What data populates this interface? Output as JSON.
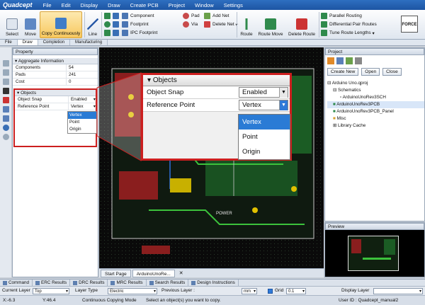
{
  "menubar": {
    "logo": "Quadcept",
    "items": [
      "File",
      "Edit",
      "Display",
      "Draw",
      "Create PCB",
      "Project",
      "Window",
      "Settings"
    ],
    "brand_color": "#1d55a3"
  },
  "toolbar": {
    "select": "Select",
    "move": "Move",
    "copy_continuously": "Copy Continuously",
    "line": "Line",
    "component": "Component",
    "footprint": "Footprint",
    "ipc_footprint": "IPC Footprint",
    "pad": "Pad",
    "via": "Via",
    "add_net": "Add Net",
    "delete_net": "Delete Net",
    "route": "Route",
    "route_move": "Route Move",
    "delete_route": "Delete Route",
    "parallel_routing": "Parallel Routing",
    "differential_pair_routes": "Differential Pair Routes",
    "tune_route_lengths": "Tune Route Lengths",
    "force_label": "FORCE"
  },
  "ribbon_tabs": [
    "File",
    "Draw",
    "Completion",
    "Manufacturing"
  ],
  "property": {
    "title": "Property",
    "aggregate_section": "Aggregate Information",
    "aggregate_rows": [
      {
        "key": "Components",
        "value": "54"
      },
      {
        "key": "Pads",
        "value": "241"
      },
      {
        "key": "Cost",
        "value": "0"
      }
    ],
    "objects_section": "Objects",
    "object_snap_key": "Object Snap",
    "object_snap_value": "Enabled",
    "reference_point_key": "Reference Point",
    "reference_point_value": "Vertex",
    "reference_options": [
      "Vertex",
      "Point",
      "Origin"
    ]
  },
  "callout": {
    "title": "Objects",
    "object_snap_key": "Object Snap",
    "object_snap_value": "Enabled",
    "reference_point_key": "Reference Point",
    "reference_point_value": "Vertex",
    "options": [
      "Vertex",
      "Point",
      "Origin"
    ],
    "border_color": "#cc1f1f"
  },
  "canvas": {
    "tabs": [
      "Start Page",
      "ArduinoUnoRe..."
    ],
    "silk_text": "POWER"
  },
  "project": {
    "title": "Project",
    "buttons": [
      "Create New",
      "Open",
      "Close"
    ],
    "tree": [
      {
        "label": "Arduino Uno.qproj",
        "level": 0
      },
      {
        "label": "Schematics",
        "level": 1
      },
      {
        "label": "ArduinoUnoRev3SCH",
        "level": 2
      },
      {
        "label": "ArduinoUnoRev3PCB",
        "level": 1,
        "selected": true
      },
      {
        "label": "ArduinoUnoRev3PCB_Panel",
        "level": 1
      },
      {
        "label": "Misc",
        "level": 1
      },
      {
        "label": "Library Cache",
        "level": 1
      }
    ]
  },
  "preview": {
    "title": "Preview"
  },
  "bottom_tabs": [
    "Command",
    "ERC Results",
    "DRC Results",
    "MRC Results",
    "Search Results",
    "Design Instructions"
  ],
  "status1": {
    "current_layer_label": "Current Layer",
    "current_layer_value": "Top",
    "layer_type_label": "Layer Type",
    "layer_type_value": "Electric",
    "previous_layer_label": "Previous Layer :",
    "unit_value": "mm",
    "grid_label": "Grid",
    "grid_value": "0.1",
    "display_layer_label": "Display Layer"
  },
  "status2": {
    "x": "X:-6.3",
    "y": "Y:46.4",
    "mode": "Continuous Copying Mode",
    "message": "Select an object(s) you want to copy.",
    "user": "User ID : Quadcept_manual2"
  }
}
